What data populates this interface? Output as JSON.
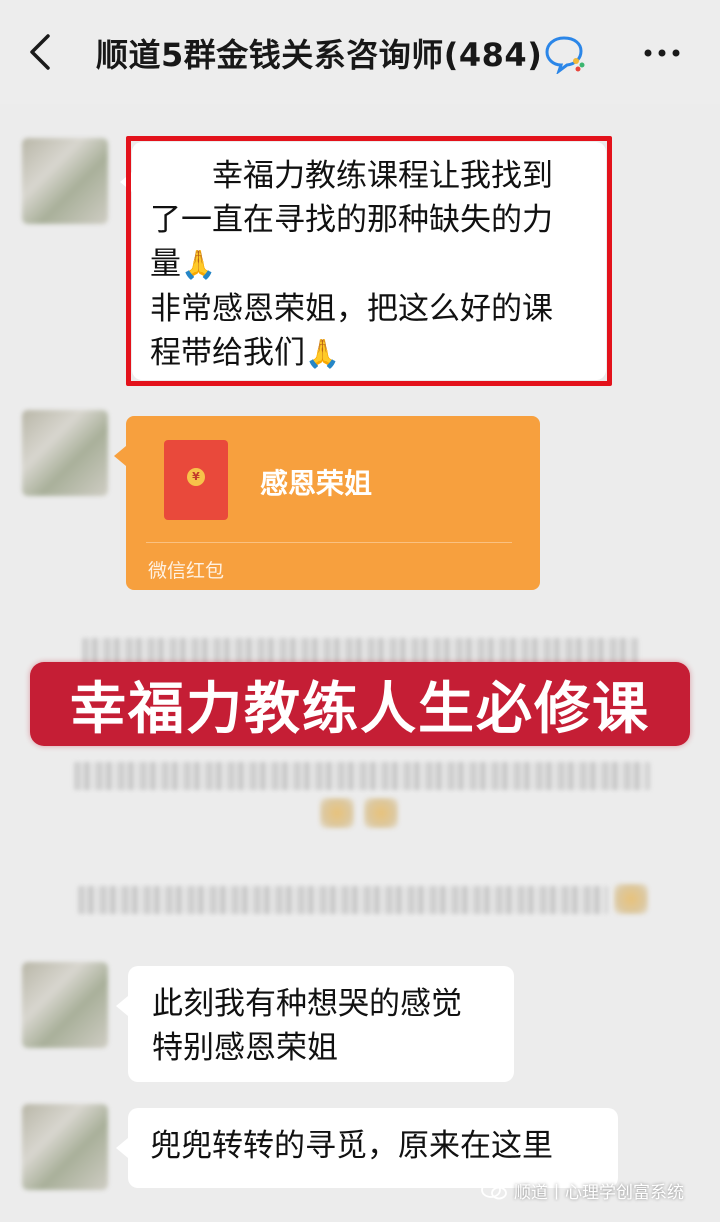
{
  "header": {
    "title": "顺道5群金钱关系咨询师(484)"
  },
  "messages": [
    {
      "lines": [
        "　　幸福力教练课程让我找到",
        "了一直在寻找的那种缺失的力",
        "量",
        "非常感恩荣姐，把这么好的课",
        "程带给我们"
      ],
      "emoji": "🙏"
    },
    {
      "type": "red_packet",
      "title": "感恩荣姐",
      "coin": "¥",
      "footer": "微信红包"
    },
    {
      "lines": [
        "此刻我有种想哭的感觉",
        "特别感恩荣姐"
      ]
    },
    {
      "lines": [
        "兜兜转转的寻觅，原来在这里"
      ]
    }
  ],
  "banner": {
    "text": "幸福力教练人生必修课"
  },
  "watermark": {
    "text": "顺道丨心理学创富系统"
  },
  "colors": {
    "highlight_border": "#e3121b",
    "red_packet": "#f7a03e",
    "banner": "#c51e35",
    "background": "#ececec"
  },
  "icons": [
    "back-arrow-icon",
    "group-chat-icon",
    "more-icon",
    "red-envelope-icon",
    "wechat-icon"
  ]
}
